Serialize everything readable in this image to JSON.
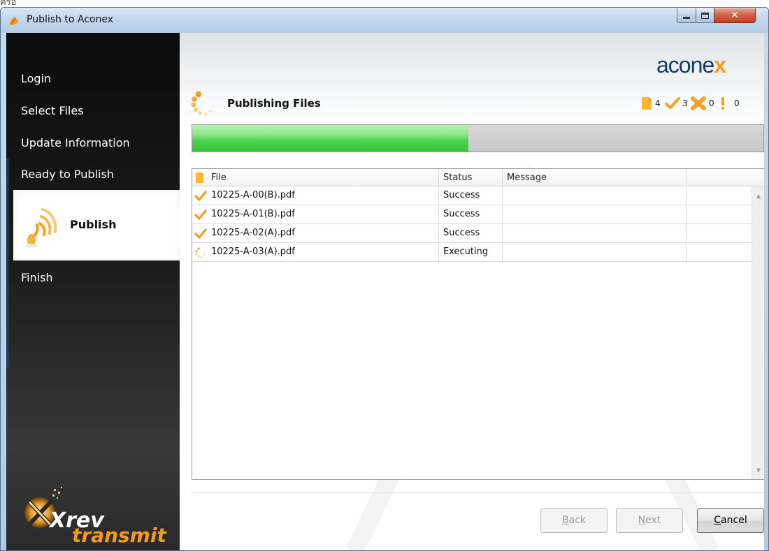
{
  "window": {
    "title": "Publish to Aconex",
    "top_fragment": "ครอ"
  },
  "sidebar": {
    "items": [
      {
        "label": "Login"
      },
      {
        "label": "Select Files"
      },
      {
        "label": "Update Information"
      },
      {
        "label": "Ready to Publish"
      },
      {
        "label": "Publish",
        "active": true
      },
      {
        "label": "Finish"
      }
    ],
    "brand": {
      "line1": "Xrev",
      "line2": "transmit"
    }
  },
  "header": {
    "logo_pre": "acone",
    "logo_x": "x",
    "title": "Publishing Files",
    "counters": {
      "total": "4",
      "success": "3",
      "failed": "0",
      "warnings": "0"
    }
  },
  "progress": {
    "fraction": 0.484
  },
  "table": {
    "columns": [
      "File",
      "Status",
      "Message"
    ],
    "rows": [
      {
        "file": "10225-A-00(B).pdf",
        "status": "Success",
        "message": "",
        "icon": "check-icon"
      },
      {
        "file": "10225-A-01(B).pdf",
        "status": "Success",
        "message": "",
        "icon": "check-icon"
      },
      {
        "file": "10225-A-02(A).pdf",
        "status": "Success",
        "message": "",
        "icon": "check-icon"
      },
      {
        "file": "10225-A-03(A).pdf",
        "status": "Executing",
        "message": "",
        "icon": "spinner-icon"
      }
    ]
  },
  "buttons": {
    "back": {
      "mn": "B",
      "rest": "ack",
      "enabled": false
    },
    "next": {
      "mn": "N",
      "rest": "ext",
      "enabled": false
    },
    "cancel": {
      "mn": "C",
      "rest": "ancel",
      "enabled": true
    }
  },
  "colors": {
    "accent_orange": "#f39c1a",
    "brand_blue": "#153a66",
    "progress_green": "#4bd44e"
  }
}
